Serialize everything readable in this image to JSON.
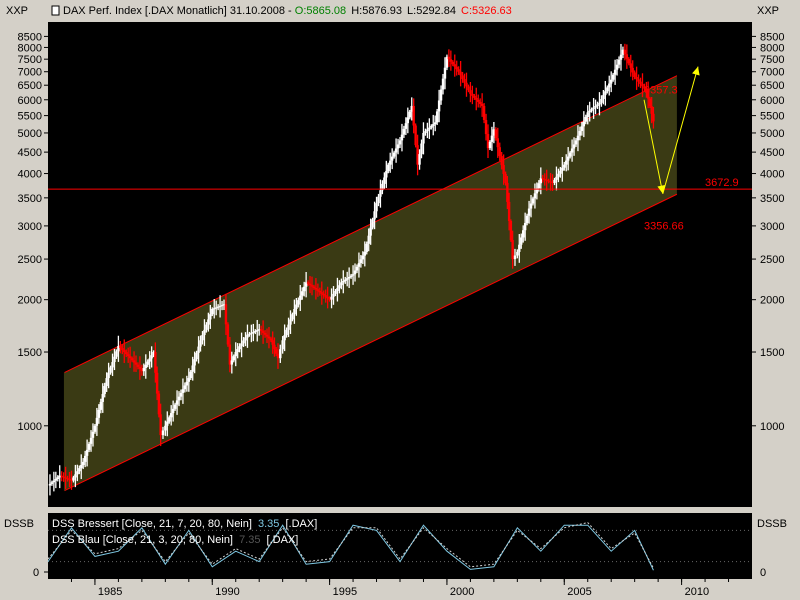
{
  "header": {
    "left_axis_label": "XXP",
    "right_axis_label": "XXP",
    "instrument": "DAX Perf. Index [.DAX  Monatlich] 31.10.2008",
    "open": "O:5865.08",
    "high": "H:5876.93",
    "low": "L:5292.84",
    "close": "C:5326.63"
  },
  "oscillator": {
    "left_label": "DSSB",
    "right_label": "DSSB",
    "zero_label": "0",
    "right_zero_label": "0",
    "line1": "DSS Bressert [Close, 21, 7, 20, 80, Nein]",
    "line1_value": "3.35",
    "line1_symbol": "[.DAX]",
    "line2": "DSS Blau [Close, 21, 3, 20, 80, Nein]",
    "line2_value": "7.35",
    "line2_symbol": "[.DAX]"
  },
  "chart_data": {
    "type": "line",
    "title": "DAX Perf. Index [.DAX  Monatlich] 31.10.2008",
    "y_scale": "log",
    "ylim": [
      640,
      9200
    ],
    "xlim": [
      1983.0,
      2013.0
    ],
    "y_ticks": [
      1000,
      1500,
      2000,
      2500,
      3000,
      3500,
      4000,
      4500,
      5000,
      5500,
      6000,
      6500,
      7000,
      7500,
      8000,
      8500
    ],
    "x_ticks": [
      1985,
      1990,
      1995,
      2000,
      2005,
      2010
    ],
    "grid": false,
    "series": [
      {
        "name": "DAX",
        "x": [
          1983.0,
          1983.5,
          1984.0,
          1984.5,
          1985.0,
          1985.5,
          1986.0,
          1986.5,
          1987.0,
          1987.5,
          1987.8,
          1988.0,
          1988.5,
          1989.0,
          1989.5,
          1990.0,
          1990.5,
          1990.75,
          1991.0,
          1991.5,
          1992.0,
          1992.5,
          1992.8,
          1993.0,
          1993.5,
          1994.0,
          1994.5,
          1995.0,
          1995.5,
          1996.0,
          1996.5,
          1997.0,
          1997.5,
          1998.0,
          1998.5,
          1998.75,
          1999.0,
          1999.5,
          2000.0,
          2000.5,
          2001.0,
          2001.5,
          2001.75,
          2002.0,
          2002.5,
          2002.8,
          2003.0,
          2003.5,
          2004.0,
          2004.5,
          2005.0,
          2005.5,
          2006.0,
          2006.5,
          2007.0,
          2007.5,
          2008.0,
          2008.5,
          2008.8
        ],
        "values": [
          720,
          760,
          740,
          820,
          1000,
          1300,
          1550,
          1450,
          1350,
          1500,
          950,
          1000,
          1150,
          1300,
          1600,
          1900,
          1950,
          1400,
          1500,
          1650,
          1700,
          1600,
          1450,
          1600,
          1900,
          2200,
          2100,
          2000,
          2200,
          2300,
          2600,
          3400,
          4200,
          4800,
          5800,
          4200,
          5000,
          5300,
          7600,
          7000,
          6200,
          5800,
          4600,
          5100,
          3800,
          2500,
          2600,
          3300,
          3900,
          3800,
          4200,
          4800,
          5600,
          5900,
          6700,
          7900,
          6800,
          6300,
          5326.63
        ]
      }
    ],
    "annotations": [
      {
        "label": "6357.3",
        "value": 6357.3,
        "color": "#ff0000"
      },
      {
        "label": "3672.9",
        "value": 3672.9,
        "color": "#ff0000"
      },
      {
        "label": "3356.66",
        "value": 3356.66,
        "color": "#ff0000"
      }
    ],
    "trend_channel": {
      "upper": {
        "x": [
          1983.7,
          2009.8
        ],
        "values": [
          1340,
          6850
        ]
      },
      "lower": {
        "x": [
          1983.7,
          2009.8
        ],
        "values": [
          700,
          3570
        ]
      },
      "fill": "#3a3a14",
      "line_color": "#ff0000"
    },
    "horizontal_line": {
      "value": 3672.9,
      "color": "#ff0000"
    },
    "projection": {
      "x": [
        2008.4,
        2009.2,
        2010.7
      ],
      "values": [
        6000,
        3580,
        7200
      ],
      "color": "#ffff00"
    },
    "oscillator_data": {
      "range": [
        0,
        100
      ],
      "levels": [
        20,
        80
      ],
      "series": [
        {
          "name": "DSS Bressert",
          "color": "#7ec8e3",
          "x": [
            1983.0,
            1984.0,
            1985.0,
            1986.0,
            1987.0,
            1988.0,
            1989.0,
            1990.0,
            1991.0,
            1992.0,
            1993.0,
            1994.0,
            1995.0,
            1996.0,
            1997.0,
            1998.0,
            1999.0,
            2000.0,
            2001.0,
            2002.0,
            2003.0,
            2004.0,
            2005.0,
            2006.0,
            2007.0,
            2008.0,
            2008.8
          ],
          "values": [
            20,
            85,
            30,
            40,
            85,
            15,
            80,
            10,
            40,
            20,
            90,
            15,
            20,
            90,
            80,
            20,
            90,
            40,
            5,
            10,
            85,
            40,
            90,
            90,
            40,
            80,
            3.35
          ]
        },
        {
          "name": "DSS Blau",
          "color": "#d0d0d0",
          "x": [
            1983.0,
            1984.0,
            1985.0,
            1986.0,
            1987.0,
            1988.0,
            1989.0,
            1990.0,
            1991.0,
            1992.0,
            1993.0,
            1994.0,
            1995.0,
            1996.0,
            1997.0,
            1998.0,
            1999.0,
            2000.0,
            2001.0,
            2002.0,
            2003.0,
            2004.0,
            2005.0,
            2006.0,
            2007.0,
            2008.0,
            2008.8
          ],
          "values": [
            25,
            80,
            35,
            45,
            80,
            20,
            75,
            15,
            45,
            25,
            85,
            20,
            25,
            85,
            85,
            25,
            85,
            45,
            10,
            15,
            80,
            45,
            85,
            95,
            45,
            75,
            7.35
          ]
        }
      ]
    }
  },
  "colors": {
    "background": "#000000",
    "frame": "#d4d0c8",
    "open_value": "#008000",
    "close_value": "#ff0000",
    "price_up": "#ffffff",
    "price_down": "#ff0000"
  }
}
